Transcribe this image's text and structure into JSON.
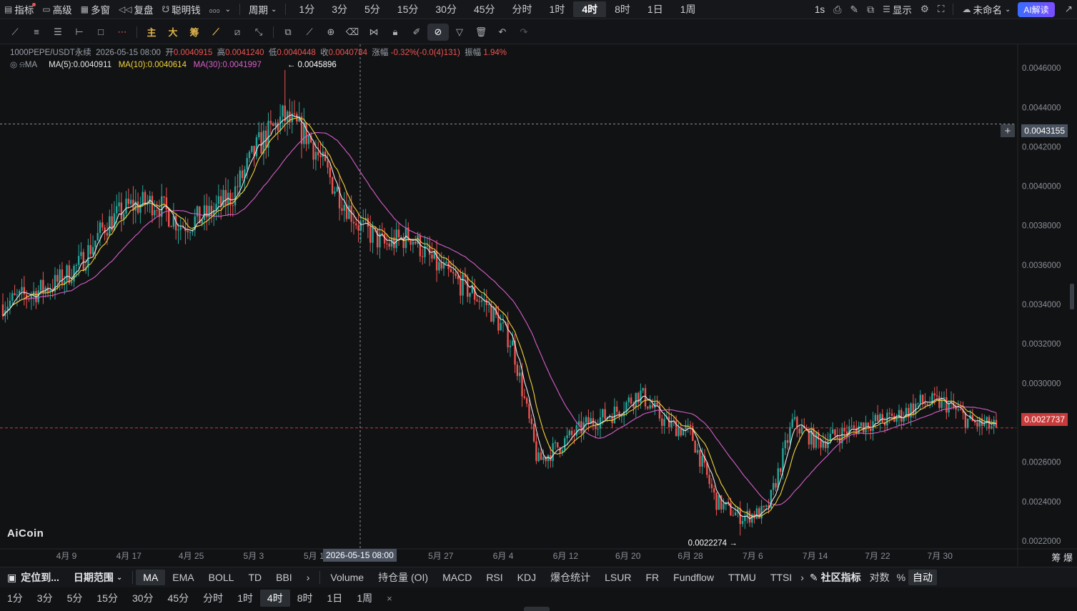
{
  "topbar": {
    "indicators": "指标",
    "advanced": "高级",
    "multi_window": "多窗",
    "replay": "复盘",
    "smart_money": "聪明钱",
    "period_menu": "周期",
    "periods": [
      "1分",
      "3分",
      "5分",
      "15分",
      "30分",
      "45分",
      "分时",
      "1时",
      "4时",
      "8时",
      "1日",
      "1周"
    ],
    "active_period": "4时",
    "interval_1s": "1s",
    "display": "显示",
    "layout_name": "未命名",
    "ai_button": "AI解读"
  },
  "drawbar": {
    "main": "主",
    "big": "大",
    "chips": "筹"
  },
  "legend": {
    "symbol": "1000PEPE/USDT永续",
    "datetime": "2026-05-15 08:00",
    "open_label": "开",
    "open": "0.0040915",
    "high_label": "高",
    "high": "0.0041240",
    "low_label": "低",
    "low": "0.0040448",
    "close_label": "收",
    "close": "0.0040784",
    "change_label": "涨幅",
    "change": "-0.32%(-0.0(4)131)",
    "amplitude_label": "振幅",
    "amplitude": "1.94%",
    "ma_name": "MA",
    "ma5": "MA(5):0.0040911",
    "ma10": "MA(10):0.0040614",
    "ma30": "MA(30):0.0041997"
  },
  "chart": {
    "logo": "AiCoin",
    "crosshair_time": "2026-05-15 08:00",
    "crosshair_price": "0.0043155",
    "current_price": "0.0027737",
    "high_marker": "← 0.0045896",
    "low_marker": "0.0022274 →",
    "corner_labels": "筹  爆",
    "colors": {
      "up": "#26a69a",
      "down": "#ef5350",
      "ma5": "#e8e8e8",
      "ma10": "#f3d33a",
      "ma30": "#d65fc8"
    }
  },
  "chart_data": {
    "type": "candlestick",
    "title": "1000PEPE/USDT永续",
    "y_ticks": [
      "0.0046000",
      "0.0044000",
      "0.0042000",
      "0.0040000",
      "0.0038000",
      "0.0036000",
      "0.0034000",
      "0.0032000",
      "0.0030000",
      "0.0028000",
      "0.0026000",
      "0.0024000",
      "0.0022000"
    ],
    "x_ticks": [
      "4月 9",
      "4月 17",
      "4月 25",
      "5月 3",
      "5月 11",
      "5月 19",
      "5月 27",
      "6月 4",
      "6月 12",
      "6月 20",
      "6月 28",
      "7月 6",
      "7月 14",
      "7月 22",
      "7月 30"
    ],
    "ylim": [
      0.00216,
      0.00472
    ],
    "anchor_closes": [
      0.0034,
      0.00345,
      0.0035,
      0.0036,
      0.0038,
      0.0039,
      0.00392,
      0.0038,
      0.00385,
      0.00395,
      0.0042,
      0.00435,
      0.00425,
      0.004,
      0.0038,
      0.0037,
      0.00375,
      0.0036,
      0.0035,
      0.0034,
      0.0032,
      0.0026,
      0.0027,
      0.0028,
      0.00285,
      0.00295,
      0.0028,
      0.00275,
      0.0024,
      0.00232,
      0.00235,
      0.0028,
      0.0027,
      0.00275,
      0.0028,
      0.00282,
      0.0029,
      0.0029,
      0.0028,
      0.0027737
    ],
    "high": 0.0045896,
    "low": 0.0022274,
    "last": 0.0027737
  },
  "indicator_bar": {
    "locate": "定位到...",
    "date_range": "日期范围",
    "main_indicators": [
      "MA",
      "EMA",
      "BOLL",
      "TD",
      "BBI"
    ],
    "active_main": "MA",
    "sub_indicators": [
      "Volume",
      "持仓量 (OI)",
      "MACD",
      "RSI",
      "KDJ",
      "爆仓统计",
      "LSUR",
      "FR",
      "Fundflow",
      "TTMU",
      "TTSI"
    ],
    "community": "社区指标",
    "log": "对数",
    "percent": "%",
    "auto": "自动"
  },
  "bottom_bar": {
    "periods": [
      "1分",
      "3分",
      "5分",
      "15分",
      "30分",
      "45分",
      "分时",
      "1时",
      "4时",
      "8时",
      "1日",
      "1周"
    ],
    "active": "4时",
    "close": "×"
  }
}
